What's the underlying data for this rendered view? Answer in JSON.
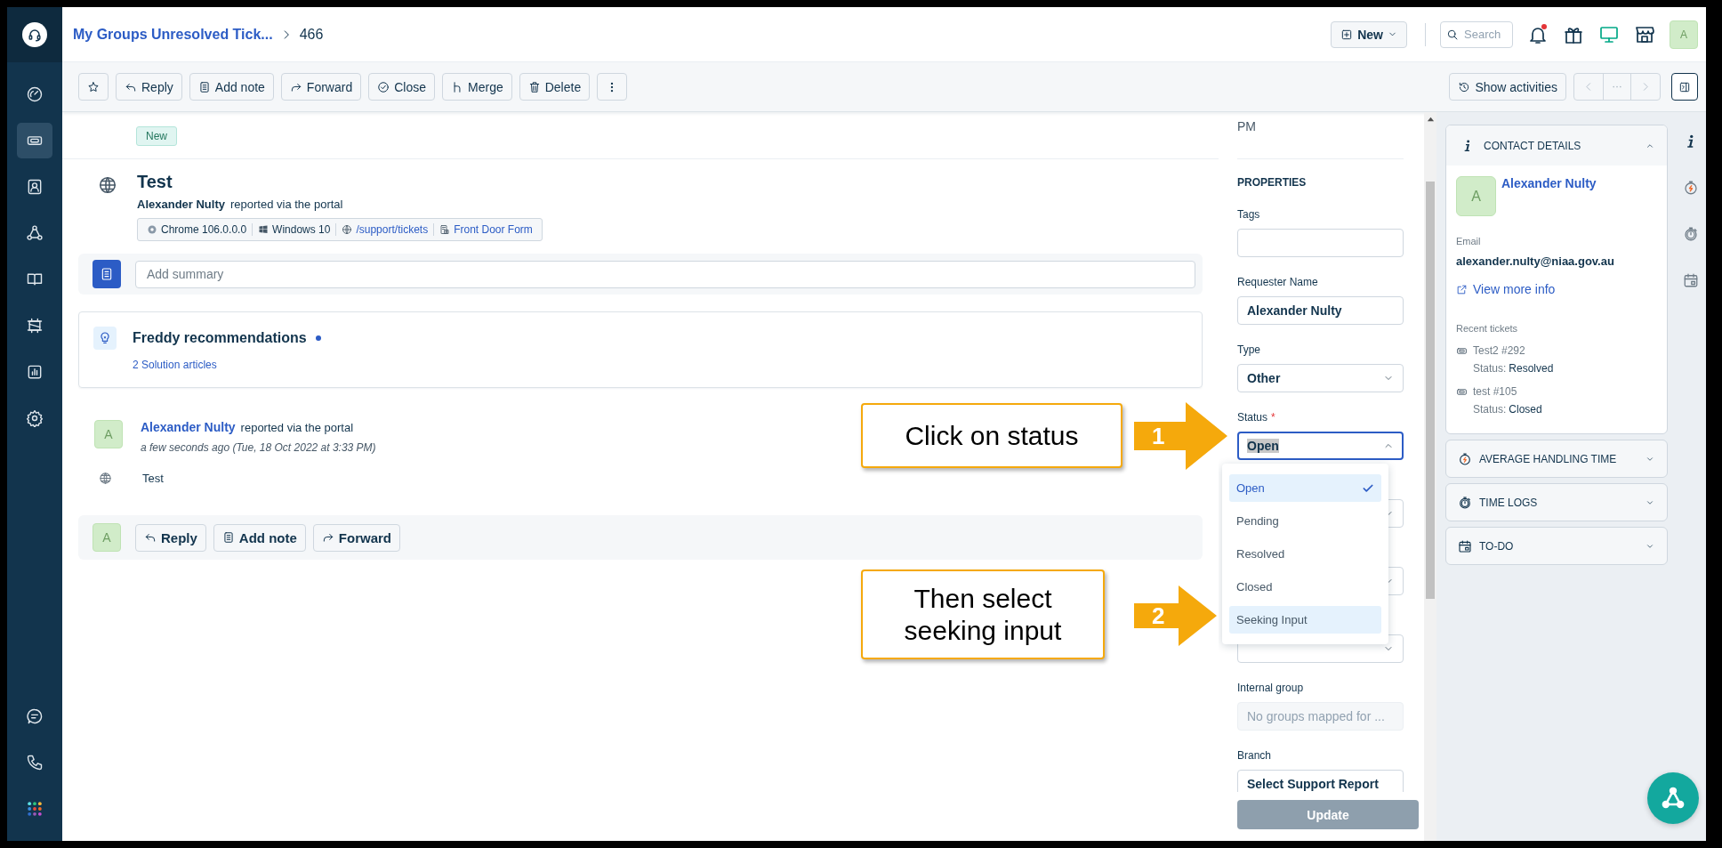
{
  "sidebar": {
    "items": [
      {
        "kind": "dashboard",
        "selected": false
      },
      {
        "kind": "tickets",
        "selected": true
      },
      {
        "kind": "contacts",
        "selected": false
      },
      {
        "kind": "groups",
        "selected": false
      },
      {
        "kind": "solutions",
        "selected": false
      },
      {
        "kind": "assets",
        "selected": false
      },
      {
        "kind": "reports",
        "selected": false
      },
      {
        "kind": "settings",
        "selected": false
      }
    ],
    "bottom_items": [
      {
        "kind": "chat"
      },
      {
        "kind": "phone"
      },
      {
        "kind": "apps"
      }
    ]
  },
  "header": {
    "breadcrumb": "My Groups Unresolved Tick...",
    "ticket_number": "466",
    "new_button": "New",
    "search_placeholder": "Search",
    "unread_notifications": true,
    "avatar": "A"
  },
  "toolbar": {
    "buttons": [
      {
        "kind": "star"
      },
      {
        "kind": "reply",
        "label": "Reply"
      },
      {
        "kind": "note",
        "label": "Add note"
      },
      {
        "kind": "forward",
        "label": "Forward"
      },
      {
        "kind": "close",
        "label": "Close"
      },
      {
        "kind": "merge",
        "label": "Merge"
      },
      {
        "kind": "delete",
        "label": "Delete"
      },
      {
        "kind": "more"
      }
    ],
    "show_activities": "Show activities"
  },
  "ticket": {
    "status_tag": "New",
    "title": "Test",
    "reporter": "Alexander Nulty",
    "reported_via": "reported via the portal",
    "meta": [
      {
        "kind": "browser",
        "text": "Chrome 106.0.0.0",
        "link": false
      },
      {
        "kind": "os",
        "text": "Windows 10",
        "link": false
      },
      {
        "kind": "url",
        "text": "/support/tickets",
        "link": true
      },
      {
        "kind": "form",
        "text": "Front Door Form",
        "link": true
      }
    ],
    "summary_placeholder": "Add summary"
  },
  "freddy": {
    "title": "Freddy recommendations",
    "link": "2 Solution articles"
  },
  "conversation": {
    "avatar": "A",
    "author": "Alexander Nulty",
    "action": "reported via the portal",
    "time": "a few seconds ago (Tue, 18 Oct 2022 at 3:33 PM)",
    "body": "Test"
  },
  "reply_bar": {
    "avatar": "A",
    "buttons": [
      {
        "kind": "reply",
        "label": "Reply"
      },
      {
        "kind": "note",
        "label": "Add note"
      },
      {
        "kind": "forward",
        "label": "Forward"
      }
    ]
  },
  "properties": {
    "cut_value": "PM",
    "heading": "PROPERTIES",
    "fields": [
      {
        "kind": "text",
        "label": "Tags",
        "disabled": false
      },
      {
        "kind": "text",
        "label": "Requester Name",
        "value": "Alexander Nulty",
        "disabled": false
      },
      {
        "kind": "select",
        "label": "Type",
        "value": "Other",
        "disabled": false,
        "expanded": false
      },
      {
        "kind": "select",
        "label": "Status",
        "required_mark": "*",
        "value": "Open",
        "disabled": false,
        "expanded": true,
        "options": [
          {
            "label": "Open",
            "selected": true,
            "hovered": false
          },
          {
            "label": "Pending",
            "selected": false,
            "hovered": false
          },
          {
            "label": "Resolved",
            "selected": false,
            "hovered": false
          },
          {
            "label": "Closed",
            "selected": false,
            "hovered": false
          },
          {
            "label": "Seeking Input",
            "selected": false,
            "hovered": true
          }
        ]
      },
      {
        "kind": "select",
        "disabled": false,
        "expanded": false
      },
      {
        "kind": "select",
        "disabled": false,
        "expanded": false
      },
      {
        "kind": "select",
        "disabled": false,
        "expanded": false
      },
      {
        "kind": "text",
        "label": "Internal group",
        "placeholder": "No groups mapped for ...",
        "disabled": true
      },
      {
        "kind": "text",
        "label": "Branch",
        "value": "Select Support Report",
        "disabled": false
      }
    ],
    "update_button": {
      "label": "Update",
      "disabled": true
    }
  },
  "contact": {
    "title": "CONTACT DETAILS",
    "expanded": true,
    "avatar": "A",
    "name": "Alexander Nulty",
    "email_label": "Email",
    "email": "alexander.nulty@niaa.gov.au",
    "view_more": "View more info",
    "recent_label": "Recent tickets",
    "tickets": [
      {
        "title": "Test2 #292",
        "status_label": "Status:",
        "status": "Resolved"
      },
      {
        "title": "test #105",
        "status_label": "Status:",
        "status": "Closed"
      }
    ]
  },
  "sections": [
    {
      "kind": "aht",
      "title": "AVERAGE HANDLING TIME",
      "expanded": false
    },
    {
      "kind": "timelogs",
      "title": "TIME LOGS",
      "expanded": false
    },
    {
      "kind": "todo",
      "title": "TO-DO",
      "expanded": false
    }
  ],
  "side_icons": [
    {
      "kind": "info"
    },
    {
      "kind": "aht"
    },
    {
      "kind": "timelogs"
    },
    {
      "kind": "todo"
    }
  ],
  "callouts": [
    {
      "text": "Click on status",
      "step": "1"
    },
    {
      "text": "Then select seeking input",
      "step": "2"
    }
  ]
}
